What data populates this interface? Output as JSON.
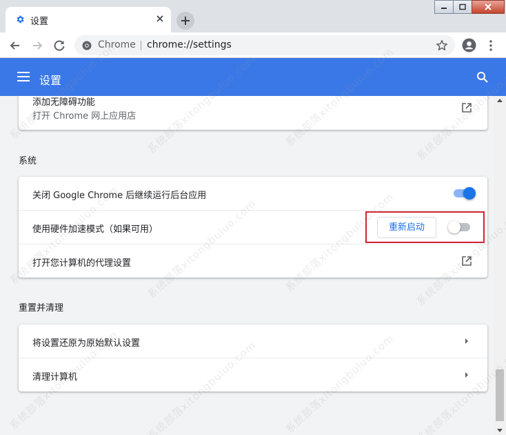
{
  "browser": {
    "tab_title": "设置",
    "omnibox_site": "Chrome",
    "omnibox_url": "chrome://settings"
  },
  "header": {
    "title": "设置"
  },
  "sections": {
    "accessibility": {
      "row_title": "添加无障碍功能",
      "row_subtitle": "打开 Chrome 网上应用店"
    },
    "system": {
      "title": "系统",
      "items": [
        {
          "label": "关闭 Google Chrome 后继续运行后台应用",
          "toggle": "on"
        },
        {
          "label": "使用硬件加速模式（如果可用）",
          "toggle": "off",
          "button": "重新启动"
        },
        {
          "label": "打开您计算机的代理设置"
        }
      ]
    },
    "reset": {
      "title": "重置并清理",
      "items": [
        {
          "label": "将设置还原为原始默认设置"
        },
        {
          "label": "清理计算机"
        }
      ]
    }
  },
  "watermark": "系统部落xitongbuluo.com",
  "colors": {
    "header_bg": "#3b78e7",
    "toggle_on": "#1a73e8",
    "highlight_border": "#d0212f"
  }
}
